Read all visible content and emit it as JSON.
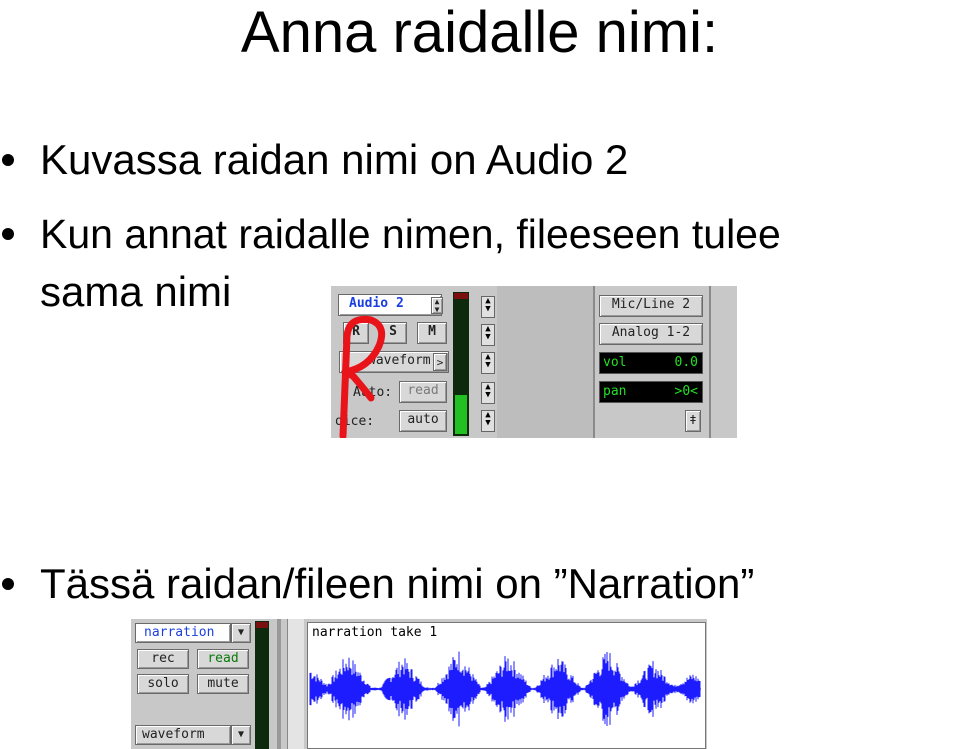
{
  "slide": {
    "title": "Anna raidalle nimi:",
    "bullets": [
      "Kuvassa raidan nimi on Audio 2",
      "Kun annat raidalle nimen, fileeseen tulee",
      "sama nimi",
      "Tässä raidan/fileen nimi on ”Narration”"
    ]
  },
  "track1": {
    "name": "Audio 2",
    "rec": "R",
    "solo": "S",
    "mute": "M",
    "view": "waveform",
    "auto_label": "Auto:",
    "auto_value": "read",
    "voice_label": "oice:",
    "voice_value": "auto",
    "input": "Mic/Line 2",
    "output": "Analog 1-2",
    "vol_label": "vol",
    "vol_value": "0.0",
    "pan_label": "pan",
    "pan_value": ">0<",
    "meter_level": 0.28,
    "annotation_color": "#e8141a"
  },
  "track2": {
    "name": "narration",
    "rec": "rec",
    "read": "read",
    "solo": "solo",
    "mute": "mute",
    "view": "waveform",
    "clip_name": "narration take 1",
    "waveform_color": "#1c1cff"
  }
}
